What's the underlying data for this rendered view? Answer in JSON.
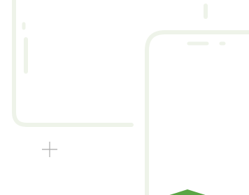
{
  "illustration": {
    "elements": [
      "tablet-outline",
      "phone-outline",
      "plus-icon",
      "green-shape"
    ],
    "colors": {
      "background": "#ffffff",
      "outline": "#eef3e9",
      "plus": "#a9a9a9",
      "accent_green": "#5aa544"
    }
  }
}
